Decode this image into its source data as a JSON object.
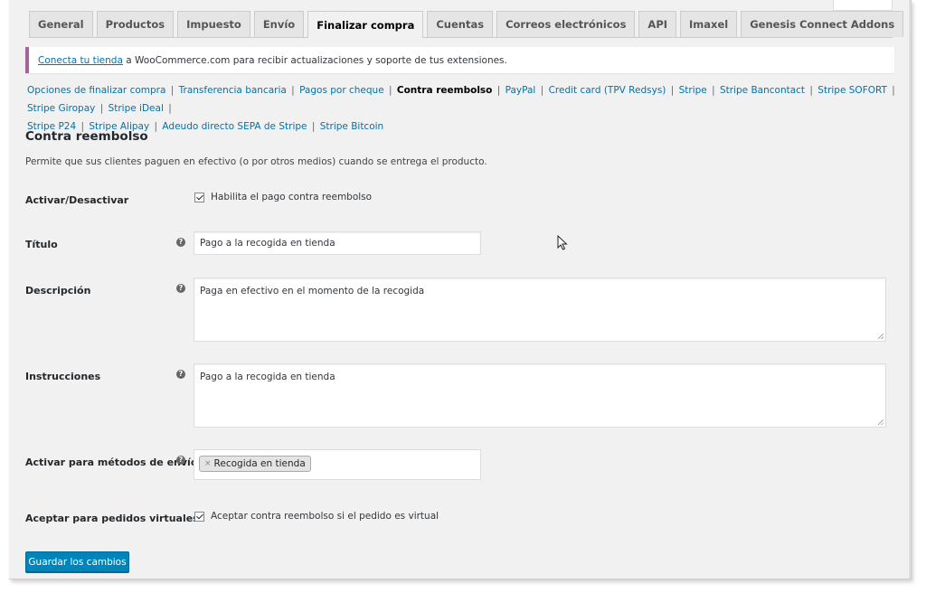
{
  "tabs": [
    {
      "label": "General",
      "active": false
    },
    {
      "label": "Productos",
      "active": false
    },
    {
      "label": "Impuesto",
      "active": false
    },
    {
      "label": "Envío",
      "active": false
    },
    {
      "label": "Finalizar compra",
      "active": true
    },
    {
      "label": "Cuentas",
      "active": false
    },
    {
      "label": "Correos electrónicos",
      "active": false
    },
    {
      "label": "API",
      "active": false
    },
    {
      "label": "Imaxel",
      "active": false
    },
    {
      "label": "Genesis Connect Addons",
      "active": false
    }
  ],
  "notice": {
    "link": "Conecta tu tienda",
    "text": " a WooCommerce.com para recibir actualizaciones y soporte de tus extensiones."
  },
  "subnav": {
    "items": [
      "Opciones de finalizar compra",
      "Transferencia bancaria",
      "Pagos por cheque",
      "Contra reembolso",
      "PayPal",
      "Credit card (TPV Redsys)",
      "Stripe",
      "Stripe Bancontact",
      "Stripe SOFORT",
      "Stripe Giropay",
      "Stripe iDeal",
      "Stripe P24",
      "Stripe Alipay",
      "Adeudo directo SEPA de Stripe",
      "Stripe Bitcoin"
    ],
    "current_index": 3
  },
  "section": {
    "title": "Contra reembolso",
    "description": "Permite que sus clientes paguen en efectivo (o por otros medios) cuando se entrega el producto."
  },
  "form": {
    "enable": {
      "label": "Activar/Desactivar",
      "checkbox_label": "Habilita el pago contra reembolso",
      "checked": true
    },
    "title": {
      "label": "Título",
      "value": "Pago a la recogida en tienda"
    },
    "description": {
      "label": "Descripción",
      "value": "Paga en efectivo en el momento de la recogida"
    },
    "instructions": {
      "label": "Instrucciones",
      "value": "Pago a la recogida en tienda"
    },
    "shipping_methods": {
      "label": "Activar para métodos de envío",
      "chips": [
        "Recogida en tienda"
      ],
      "chip_remove": "×"
    },
    "virtual": {
      "label": "Aceptar para pedidos virtuales",
      "checkbox_label": "Aceptar contra reembolso si el pedido es virtual",
      "checked": true
    },
    "help_glyph": "?"
  },
  "save_button": "Guardar los cambios",
  "colors": {
    "link": "#0073aa",
    "notice_border": "#a46497",
    "primary_button": "#0085ba"
  }
}
